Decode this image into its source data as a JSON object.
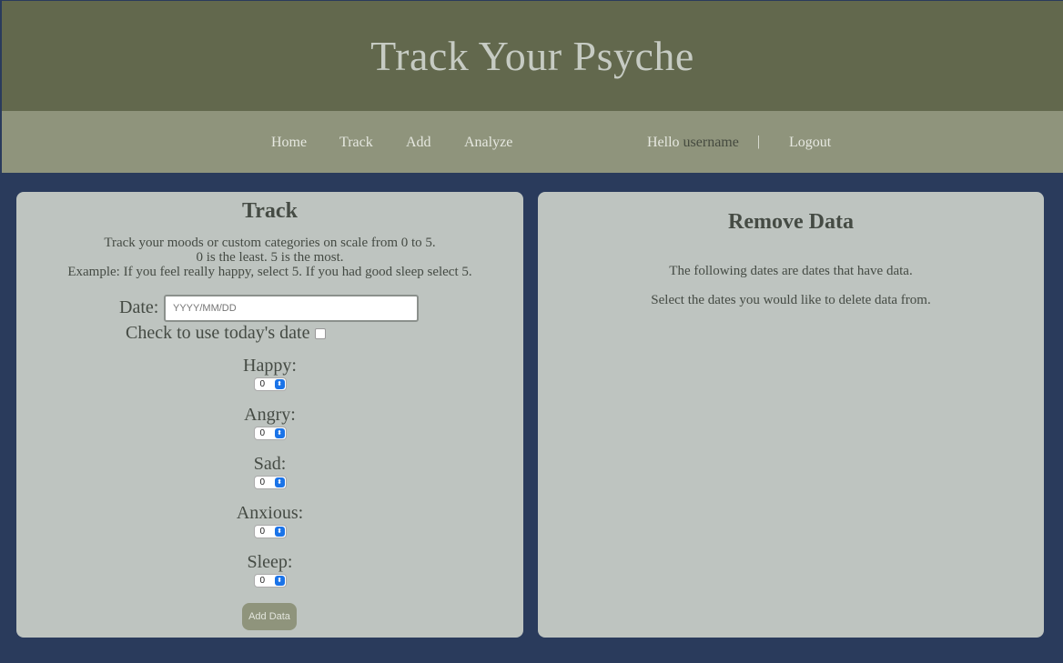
{
  "header": {
    "title": "Track Your Psyche"
  },
  "nav": {
    "links": [
      {
        "label": "Home"
      },
      {
        "label": "Track"
      },
      {
        "label": "Add"
      },
      {
        "label": "Analyze"
      }
    ],
    "hello_prefix": "Hello",
    "username": "username",
    "separator": "|",
    "logout": "Logout"
  },
  "track": {
    "title": "Track",
    "desc_line1": "Track your moods or custom categories on scale from 0 to 5.",
    "desc_line2": "0 is the least. 5 is the most.",
    "desc_line3": "Example: If you feel really happy, select 5. If you had good sleep select 5.",
    "date_label": "Date:",
    "date_placeholder": "YYYY/MM/DD",
    "today_label": "Check to use today's date",
    "fields": [
      {
        "label": "Happy:",
        "value": "0"
      },
      {
        "label": "Angry:",
        "value": "0"
      },
      {
        "label": "Sad:",
        "value": "0"
      },
      {
        "label": "Anxious:",
        "value": "0"
      },
      {
        "label": "Sleep:",
        "value": "0"
      }
    ],
    "add_button": "Add Data"
  },
  "remove": {
    "title": "Remove Data",
    "line1": "The following dates are dates that have data.",
    "line2": "Select the dates you would like to delete data from."
  },
  "colors": {
    "header_bg": "#62684d",
    "nav_bg": "#8f947c",
    "page_bg": "#2a3b5c",
    "panel_bg": "#bec4c0"
  }
}
